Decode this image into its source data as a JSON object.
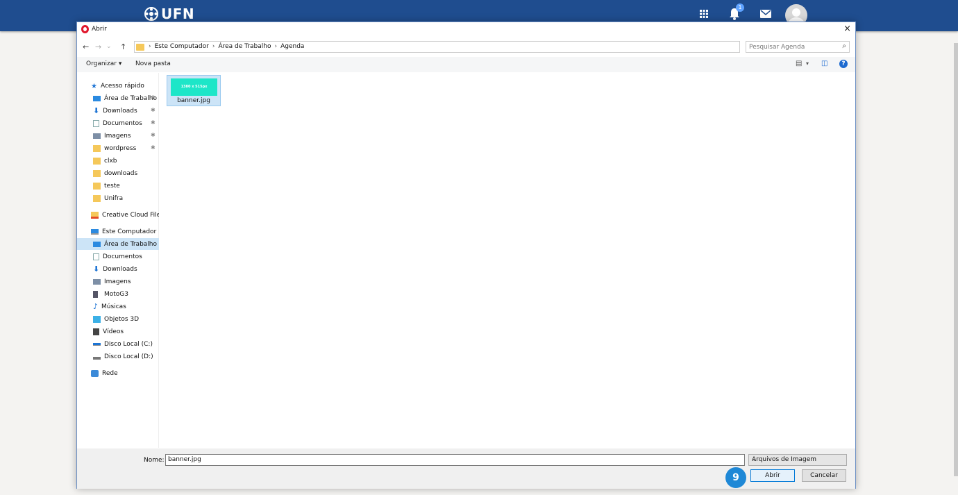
{
  "header": {
    "logo_text": "UFN",
    "notification_count": "1",
    "colors": {
      "bar": "#1f4d8f",
      "badge": "#5fa3ff"
    }
  },
  "dialog": {
    "title": "Abrir",
    "close_label": "×",
    "nav": {
      "back": "←",
      "forward": "→",
      "recent": "⌄",
      "up": "↑",
      "refresh": "↻",
      "dropdown": "⌄"
    },
    "breadcrumb": [
      "Este Computador",
      "Área de Trabalho",
      "Agenda"
    ],
    "breadcrumb_sep": "›",
    "search_placeholder": "Pesquisar Agenda",
    "toolbar": {
      "organize": "Organizar ▾",
      "new_folder": "Nova pasta",
      "help": "?"
    },
    "sidebar": {
      "items": [
        {
          "label": "Acesso rápido",
          "icon": "star-icon"
        },
        {
          "label": "Área de Trabalho",
          "icon": "desktop-icon",
          "pinned": true
        },
        {
          "label": "Downloads",
          "icon": "download-arrow-icon",
          "pinned": true
        },
        {
          "label": "Documentos",
          "icon": "document-icon",
          "pinned": true
        },
        {
          "label": "Imagens",
          "icon": "image-icon",
          "pinned": true
        },
        {
          "label": "wordpress",
          "icon": "folder-icon",
          "pinned": true
        },
        {
          "label": "clxb",
          "icon": "folder-icon"
        },
        {
          "label": "downloads",
          "icon": "folder-icon"
        },
        {
          "label": "teste",
          "icon": "folder-icon"
        },
        {
          "label": "Unifra",
          "icon": "folder-icon"
        },
        {
          "label": "Creative Cloud Files",
          "icon": "creative-cloud-folder-icon"
        },
        {
          "label": "Este Computador",
          "icon": "computer-icon"
        },
        {
          "label": "Área de Trabalho",
          "icon": "desktop-icon",
          "selected": true
        },
        {
          "label": "Documentos",
          "icon": "document-icon"
        },
        {
          "label": "Downloads",
          "icon": "download-arrow-icon"
        },
        {
          "label": "Imagens",
          "icon": "image-icon"
        },
        {
          "label": "MotoG3",
          "icon": "phone-icon"
        },
        {
          "label": "Músicas",
          "icon": "music-note-icon"
        },
        {
          "label": "Objetos 3D",
          "icon": "cube-icon"
        },
        {
          "label": "Vídeos",
          "icon": "film-icon"
        },
        {
          "label": "Disco Local (C:)",
          "icon": "drive-windows-icon"
        },
        {
          "label": "Disco Local (D:)",
          "icon": "drive-icon"
        },
        {
          "label": "Rede",
          "icon": "network-icon"
        }
      ]
    },
    "files": [
      {
        "name": "banner.jpg",
        "thumb_text": "1380 x 515px",
        "thumb_color": "#1de6c8",
        "selected": true
      }
    ],
    "footer": {
      "name_label": "Nome:",
      "name_value": "banner.jpg",
      "type_value": "Arquivos de Imagem",
      "open_label": "Abrir",
      "cancel_label": "Cancelar",
      "step_badge": "9"
    }
  }
}
